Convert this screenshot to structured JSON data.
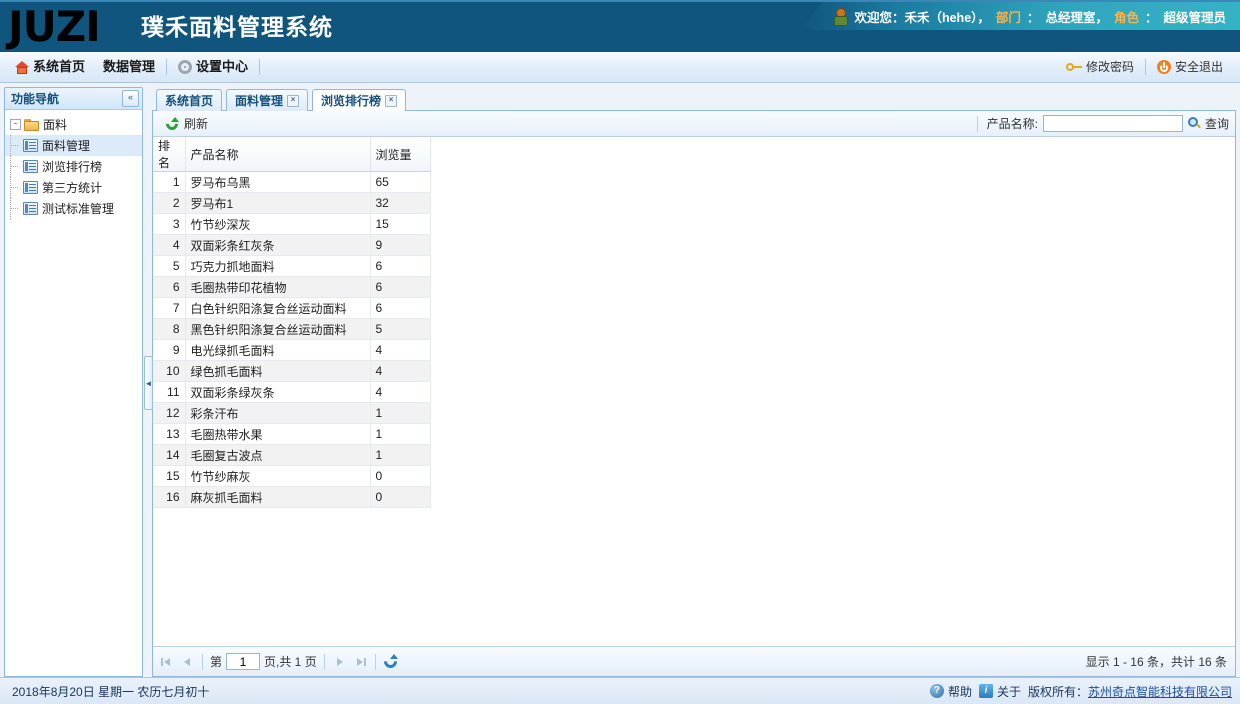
{
  "header": {
    "logo": "JUZI",
    "logo_sub": "璞禾面料管理系统",
    "welcome": {
      "user_icon": "user-icon",
      "prefix": "欢迎您：禾禾（hehe），",
      "dept_label": "部门",
      "dept_sep": "：",
      "dept_value": "总经理室，",
      "role_label": "角色",
      "role_sep": "：",
      "role_value": "超级管理员"
    },
    "accent_orange": "#ffb347",
    "bg_color": "#10557d"
  },
  "menubar": {
    "left": [
      {
        "label": "系统首页",
        "icon": "home-icon"
      },
      {
        "label": "数据管理",
        "icon": ""
      },
      {
        "label": "设置中心",
        "icon": "gear-icon"
      }
    ],
    "right": [
      {
        "label": "修改密码",
        "icon": "key-icon"
      },
      {
        "label": "安全退出",
        "icon": "power-icon"
      }
    ]
  },
  "sidebar": {
    "title": "功能导航",
    "collapse_icon": "«",
    "root": {
      "label": "面料",
      "expander": "-",
      "icon": "folder-icon"
    },
    "items": [
      {
        "label": "面料管理",
        "icon": "document-icon",
        "selected": true
      },
      {
        "label": "浏览排行榜",
        "icon": "document-icon",
        "selected": false
      },
      {
        "label": "第三方统计",
        "icon": "document-icon",
        "selected": false
      },
      {
        "label": "测试标准管理",
        "icon": "document-icon",
        "selected": false
      }
    ]
  },
  "splitter": {
    "handle_icon": "◄"
  },
  "tabs": [
    {
      "label": "系统首页",
      "closable": false,
      "active": false
    },
    {
      "label": "面料管理",
      "closable": true,
      "active": false
    },
    {
      "label": "浏览排行榜",
      "closable": true,
      "active": true
    }
  ],
  "tab_close_icon": "×",
  "toolbar": {
    "refresh_label": "刷新",
    "refresh_icon": "refresh-icon",
    "search_label": "产品名称:",
    "search_value": "",
    "search_placeholder": "",
    "query_label": "查询",
    "query_icon": "search-icon"
  },
  "grid": {
    "columns": [
      "排名",
      "产品名称",
      "浏览量"
    ],
    "rows": [
      {
        "rank": "1",
        "name": "罗马布乌黑",
        "views": "65"
      },
      {
        "rank": "2",
        "name": "罗马布1",
        "views": "32"
      },
      {
        "rank": "3",
        "name": "竹节纱深灰",
        "views": "15"
      },
      {
        "rank": "4",
        "name": "双面彩条红灰条",
        "views": "9"
      },
      {
        "rank": "5",
        "name": "巧克力抓地面料",
        "views": "6"
      },
      {
        "rank": "6",
        "name": "毛圈热带印花植物",
        "views": "6"
      },
      {
        "rank": "7",
        "name": "白色针织阳涤复合丝运动面料",
        "views": "6"
      },
      {
        "rank": "8",
        "name": "黑色针织阳涤复合丝运动面料",
        "views": "5"
      },
      {
        "rank": "9",
        "name": "电光绿抓毛面料",
        "views": "4"
      },
      {
        "rank": "10",
        "name": "绿色抓毛面料",
        "views": "4"
      },
      {
        "rank": "11",
        "name": "双面彩条绿灰条",
        "views": "4"
      },
      {
        "rank": "12",
        "name": "彩条汗布",
        "views": "1"
      },
      {
        "rank": "13",
        "name": "毛圈热带水果",
        "views": "1"
      },
      {
        "rank": "14",
        "name": "毛圈复古波点",
        "views": "1"
      },
      {
        "rank": "15",
        "name": "竹节纱麻灰",
        "views": "0"
      },
      {
        "rank": "16",
        "name": "麻灰抓毛面料",
        "views": "0"
      }
    ]
  },
  "pager": {
    "first_icon": "first-page-icon",
    "prev_icon": "prev-page-icon",
    "page_prefix": "第",
    "page_value": "1",
    "page_suffix": "页,共 1 页",
    "next_icon": "next-page-icon",
    "last_icon": "last-page-icon",
    "refresh_icon": "refresh-icon",
    "summary": "显示 1 - 16 条，共计 16 条"
  },
  "footer": {
    "date": "2018年8月20日 星期一 农历七月初十",
    "help_label": "帮助",
    "help_icon": "help-icon",
    "about_label": "关于",
    "about_icon": "info-icon",
    "copyright_prefix": "版权所有：",
    "company": "苏州奇点智能科技有限公司"
  }
}
